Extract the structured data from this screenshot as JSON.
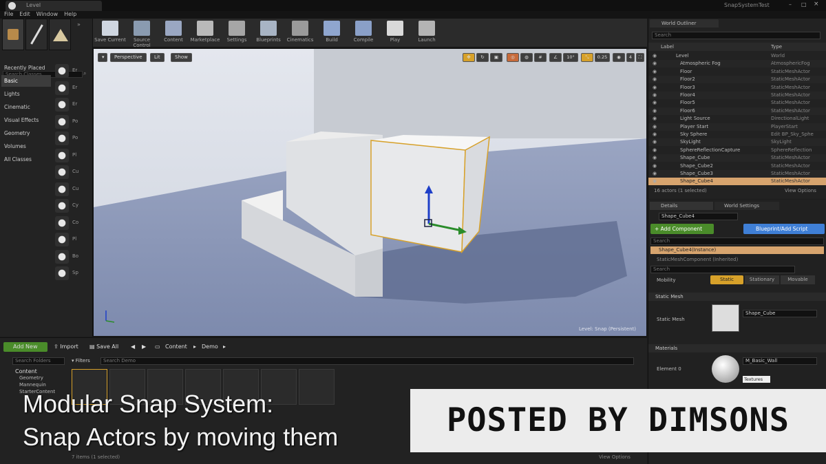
{
  "window": {
    "tab": "Level",
    "project": "SnapSystemTest"
  },
  "menu": [
    "File",
    "Edit",
    "Window",
    "Help"
  ],
  "toolbar": [
    {
      "label": "Save Current",
      "icon": "save-icon",
      "color": "#cfd6e0"
    },
    {
      "label": "Source Control",
      "icon": "source-control-icon",
      "color": "#8a9bb0"
    },
    {
      "label": "Content",
      "icon": "content-icon",
      "color": "#9aa7c2"
    },
    {
      "label": "Marketplace",
      "icon": "marketplace-icon",
      "color": "#b9b9b9"
    },
    {
      "label": "Settings",
      "icon": "settings-icon",
      "color": "#a6a6a6"
    },
    {
      "label": "Blueprints",
      "icon": "blueprints-icon",
      "color": "#a8b4c4"
    },
    {
      "label": "Cinematics",
      "icon": "cinematics-icon",
      "color": "#9a9a9a"
    },
    {
      "label": "Build",
      "icon": "build-icon",
      "color": "#8fa6cf"
    },
    {
      "label": "Compile",
      "icon": "compile-icon",
      "color": "#8aa0c8"
    },
    {
      "label": "Play",
      "icon": "play-icon",
      "color": "#d9d9d9"
    },
    {
      "label": "Launch",
      "icon": "launch-icon",
      "color": "#b4b4b4"
    }
  ],
  "modes": {
    "search_placeholder": "Search Classes",
    "categories": [
      "Recently Placed",
      "Basic",
      "Lights",
      "Cinematic",
      "Visual Effects",
      "Geometry",
      "Volumes",
      "All Classes"
    ],
    "active_category": "Basic",
    "items": [
      "Er",
      "Er",
      "Er",
      "Po",
      "Po",
      "Pl",
      "Cu",
      "Cu",
      "Cy",
      "Co",
      "Pl",
      "Bo",
      "Sp"
    ]
  },
  "viewport": {
    "perspective": "Perspective",
    "lit": "Lit",
    "show": "Show",
    "snap_angle": "10°",
    "scale": "0.25",
    "camera_speed": "4",
    "level_label": "Level: Snap (Persistent)",
    "colors": {
      "sky": "#dfe3eb",
      "floor": "#8b98ba",
      "gizmo_z": "#1e3fc8",
      "gizmo_y": "#2a8c2a",
      "selection": "#d7a12a"
    }
  },
  "outliner": {
    "tab": "World Outliner",
    "search_placeholder": "Search",
    "col_label": "Label",
    "col_type": "Type",
    "rows": [
      {
        "label": "Level",
        "type": "World",
        "indent": 0
      },
      {
        "label": "Atmospheric Fog",
        "type": "AtmosphericFog",
        "indent": 1
      },
      {
        "label": "Floor",
        "type": "StaticMeshActor",
        "indent": 1
      },
      {
        "label": "Floor2",
        "type": "StaticMeshActor",
        "indent": 1
      },
      {
        "label": "Floor3",
        "type": "StaticMeshActor",
        "indent": 1
      },
      {
        "label": "Floor4",
        "type": "StaticMeshActor",
        "indent": 1
      },
      {
        "label": "Floor5",
        "type": "StaticMeshActor",
        "indent": 1
      },
      {
        "label": "Floor6",
        "type": "StaticMeshActor",
        "indent": 1
      },
      {
        "label": "Light Source",
        "type": "DirectionalLight",
        "indent": 1
      },
      {
        "label": "Player Start",
        "type": "PlayerStart",
        "indent": 1
      },
      {
        "label": "Sky Sphere",
        "type": "Edit BP_Sky_Sphe",
        "indent": 1
      },
      {
        "label": "SkyLight",
        "type": "SkyLight",
        "indent": 1
      },
      {
        "label": "SphereReflectionCapture",
        "type": "SphereReflection",
        "indent": 1
      },
      {
        "label": "Shape_Cube",
        "type": "StaticMeshActor",
        "indent": 1
      },
      {
        "label": "Shape_Cube2",
        "type": "StaticMeshActor",
        "indent": 1
      },
      {
        "label": "Shape_Cube3",
        "type": "StaticMeshActor",
        "indent": 1
      },
      {
        "label": "Shape_Cube4",
        "type": "StaticMeshActor",
        "indent": 1
      }
    ],
    "selected": "Shape_Cube4",
    "footer": "16 actors (1 selected)",
    "view_options": "View Options"
  },
  "details": {
    "tabs": [
      "Details",
      "World Settings"
    ],
    "name": "Shape_Cube4",
    "add_component": "+ Add Component",
    "blueprint": "Blueprint/Add Script",
    "search_placeholder": "Search",
    "instance": "Shape_Cube4(Instance)",
    "component": "StaticMeshComponent (Inherited)",
    "mobility_label": "Mobility",
    "mobility": [
      "Static",
      "Stationary",
      "Movable"
    ],
    "section_mesh": "Static Mesh",
    "static_mesh_label": "Static Mesh",
    "static_mesh": "Shape_Cube",
    "section_materials": "Materials",
    "element_label": "Element 0",
    "material": "M_Basic_Wall",
    "textures": "Textures",
    "accent": "#3f7fd6",
    "add_color": "#4a8c2a"
  },
  "content": {
    "add_new": "Add New",
    "import": "Import",
    "save_all": "Save All",
    "path": [
      "Content",
      "Demo"
    ],
    "search_folders": "Search Folders",
    "filters": "Filters",
    "search_demo": "Search Demo",
    "tree": [
      "Content",
      "Geometry",
      "Mannequin",
      "StarterContent"
    ],
    "items_count": "7 items (1 selected)",
    "view_options": "View Options"
  },
  "caption": {
    "line1": "Modular Snap System:",
    "line2": "Snap Actors by moving them"
  },
  "watermark": "POSTED BY DIMSONS"
}
